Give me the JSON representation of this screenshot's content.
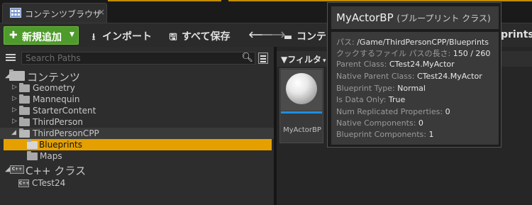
{
  "tab": {
    "title": "コンテンツブラウザ",
    "close": "×"
  },
  "toolbar": {
    "add_new": "新規追加",
    "import": "インポート",
    "save_all": "すべて保存",
    "content_crumb": "コンテ",
    "blueprints_crumb": "prints"
  },
  "search": {
    "placeholder": "Search Paths"
  },
  "tree": {
    "root": "コンテンツ",
    "items": [
      "Geometry",
      "Mannequin",
      "StarterContent",
      "ThirdPerson",
      "ThirdPersonCPP",
      "Blueprints",
      "Maps"
    ],
    "cpp_root": "C++ クラス",
    "cpp_items": [
      "CTest24"
    ]
  },
  "filter": {
    "label": "フィルタ"
  },
  "asset": {
    "name": "MyActorBP"
  },
  "tooltip": {
    "title": "MyActorBP",
    "subtitle": "(ブループリント クラス)",
    "rows": [
      {
        "k": "パス:",
        "v": "/Game/ThirdPersonCPP/Blueprints"
      },
      {
        "k": "クックするファイル パスの長さ:",
        "v": "150 / 260"
      },
      {
        "k": "Parent Class:",
        "v": "CTest24.MyActor"
      },
      {
        "k": "Native Parent Class:",
        "v": "CTest24.MyActor"
      },
      {
        "k": "Blueprint Type:",
        "v": "Normal"
      },
      {
        "k": "Is Data Only:",
        "v": "True"
      },
      {
        "k": "Num Replicated Properties:",
        "v": "0"
      },
      {
        "k": "Native Components:",
        "v": "0"
      },
      {
        "k": "Blueprint Components:",
        "v": "1"
      }
    ]
  },
  "colors": {
    "selection": "#e5a000",
    "add_button": "#4e9a2a",
    "accent_line": "#c08e00",
    "asset_bar": "#1e8fe0"
  }
}
